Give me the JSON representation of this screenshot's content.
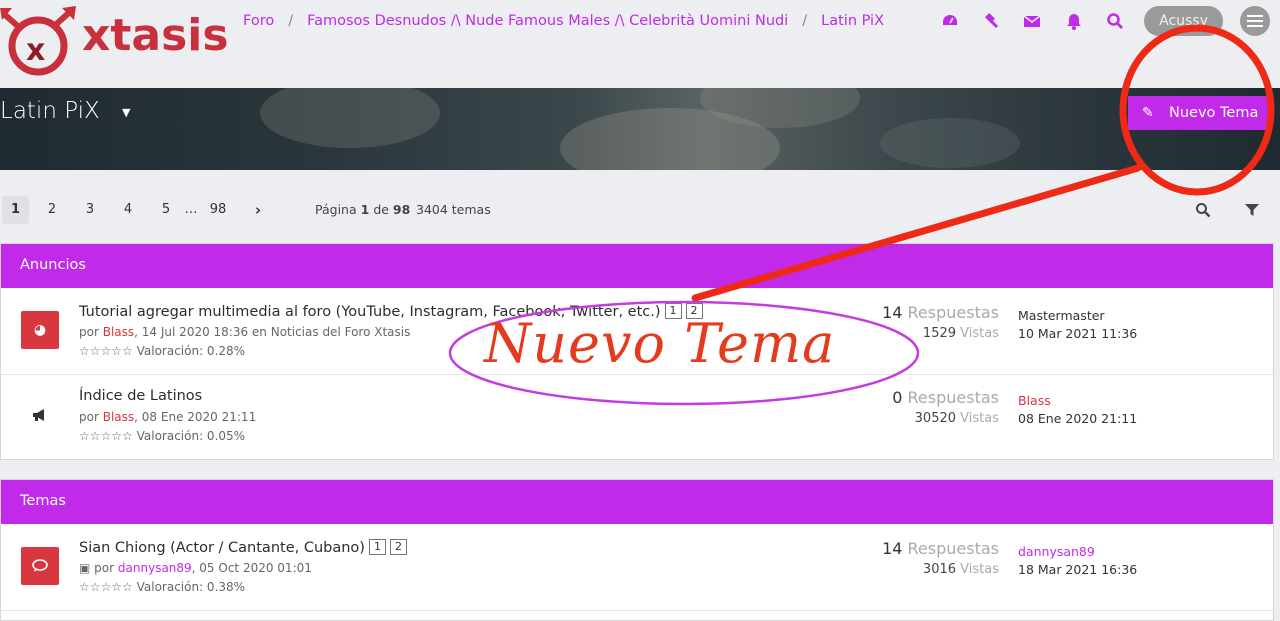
{
  "header": {
    "logo_text": "xtasis",
    "breadcrumb": [
      "Foro",
      "Famosos Desnudos /\\ Nude Famous Males /\\ Celebrità Uomini Nudi",
      "Latin PiX"
    ],
    "user_label": "Acussy",
    "icons": [
      "dashboard-icon",
      "gavel-icon",
      "envelope-icon",
      "bell-icon",
      "search-icon",
      "menu-icon"
    ]
  },
  "banner": {
    "title": "Latin PiX",
    "new_topic_label": "Nuevo Tema"
  },
  "pagination": {
    "pages": [
      "1",
      "2",
      "3",
      "4",
      "5",
      "…",
      "98"
    ],
    "active": "1",
    "info_prefix": "Página",
    "info_current": "1",
    "info_mid": "de",
    "info_total": "98",
    "topic_count": "3404 temas"
  },
  "announcements": {
    "heading": "Anuncios",
    "rows": [
      {
        "title": "Tutorial agregar multimedia al foro (YouTube, Instagram, Facebook, Twitter, etc.)",
        "pages": [
          "1",
          "2"
        ],
        "by": "por",
        "author": "Blass",
        "date_text": ", 14 Jul 2020 18:36 en Noticias del Foro Xtasis",
        "rating": "☆☆☆☆☆ Valoración: 0.28%",
        "replies": "14",
        "replies_word": "Respuestas",
        "views": "1529",
        "views_word": "Vistas",
        "last_user": "Mastermaster",
        "last_date": "10 Mar 2021 11:36"
      },
      {
        "title": "Índice de Latinos",
        "pages": [],
        "by": "por",
        "author": "Blass",
        "date_text": ", 08 Ene 2020 21:11",
        "rating": "☆☆☆☆☆ Valoración: 0.05%",
        "replies": "0",
        "replies_word": "Respuestas",
        "views": "30520",
        "views_word": "Vistas",
        "last_user": "Blass",
        "last_date": "08 Ene 2020 21:11"
      }
    ]
  },
  "topics": {
    "heading": "Temas",
    "rows": [
      {
        "title": "Sian Chiong (Actor / Cantante, Cubano)",
        "pages": [
          "1",
          "2"
        ],
        "by": "por",
        "author": "dannysan89",
        "date_text": ", 05 Oct 2020 01:01",
        "rating": "☆☆☆☆☆ Valoración: 0.38%",
        "replies": "14",
        "replies_word": "Respuestas",
        "views": "3016",
        "views_word": "Vistas",
        "last_user": "dannysan89",
        "last_date": "18 Mar 2021 16:36"
      }
    ]
  },
  "annotation": {
    "text": "Nuevo Tema"
  },
  "colors": {
    "accent": "#c12ae8",
    "red": "#d7373f",
    "annotation_red": "#e43b1e"
  }
}
